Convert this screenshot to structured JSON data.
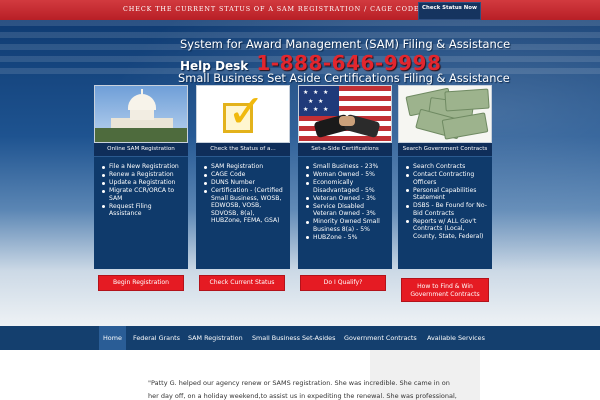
{
  "top_banner": {
    "text": "CHECK THE CURRENT STATUS OF A SAM REGISTRATION / CAGE CODE / DUNS NUMBER",
    "button_label": "Check Status Now"
  },
  "hero": {
    "line1": "System for Award Management (SAM) Filing & Assistance",
    "helpdesk_label": "Help Desk",
    "phone": "1-888-646-9998",
    "line3": "Small Business Set Aside Certifications Filing & Assistance"
  },
  "cards": [
    {
      "title": "Online SAM Registration",
      "items": [
        "File a New Registration",
        "Renew a Registration",
        "Update a Registration",
        "Migrate CCR/ORCA to SAM",
        "Request Filing Assistance"
      ],
      "cta": "Begin Registration"
    },
    {
      "title": "Check the Status of a...",
      "items": [
        "SAM Registration",
        "CAGE Code",
        "DUNS Number",
        "Certification - (Certified Small Business, WOSB, EDWOSB, VOSB, SDVOSB, 8(a), HUBZone, FEMA, GSA)"
      ],
      "cta": "Check Current Status"
    },
    {
      "title": "Set-a-Side Certifications",
      "items": [
        "Small Business - 23%",
        "Woman Owned - 5%",
        "Economically Disadvantaged - 5%",
        "Veteran Owned - 3%",
        "Service Disabled Veteran Owned - 3%",
        "Minority Owned Small Business 8(a) - 5%",
        "HUBZone - 5%"
      ],
      "cta": "Do I Qualify?"
    },
    {
      "title": "Search Government Contracts",
      "items": [
        "Search Contracts",
        "Contact Contracting Officers",
        "Personal Capabilities Statement",
        "DSBS - Be Found for No-Bid Contracts",
        "Reports w/ ALL Gov't Contracts (Local, County, State, Federal)"
      ],
      "cta": "How to Find & Win Government Contracts"
    }
  ],
  "nav": [
    "Home",
    "Federal Grants",
    "SAM Registration",
    "Small Business Set-Asides",
    "Government Contracts",
    "Available Services"
  ],
  "testimonial": {
    "line1": "\"Patty G. helped our agency renew or SAMS registration. She was incredible. She came in on",
    "line2": "her day off, on a holiday weekend,to assist us in expediting the renewal. She was professional,"
  }
}
